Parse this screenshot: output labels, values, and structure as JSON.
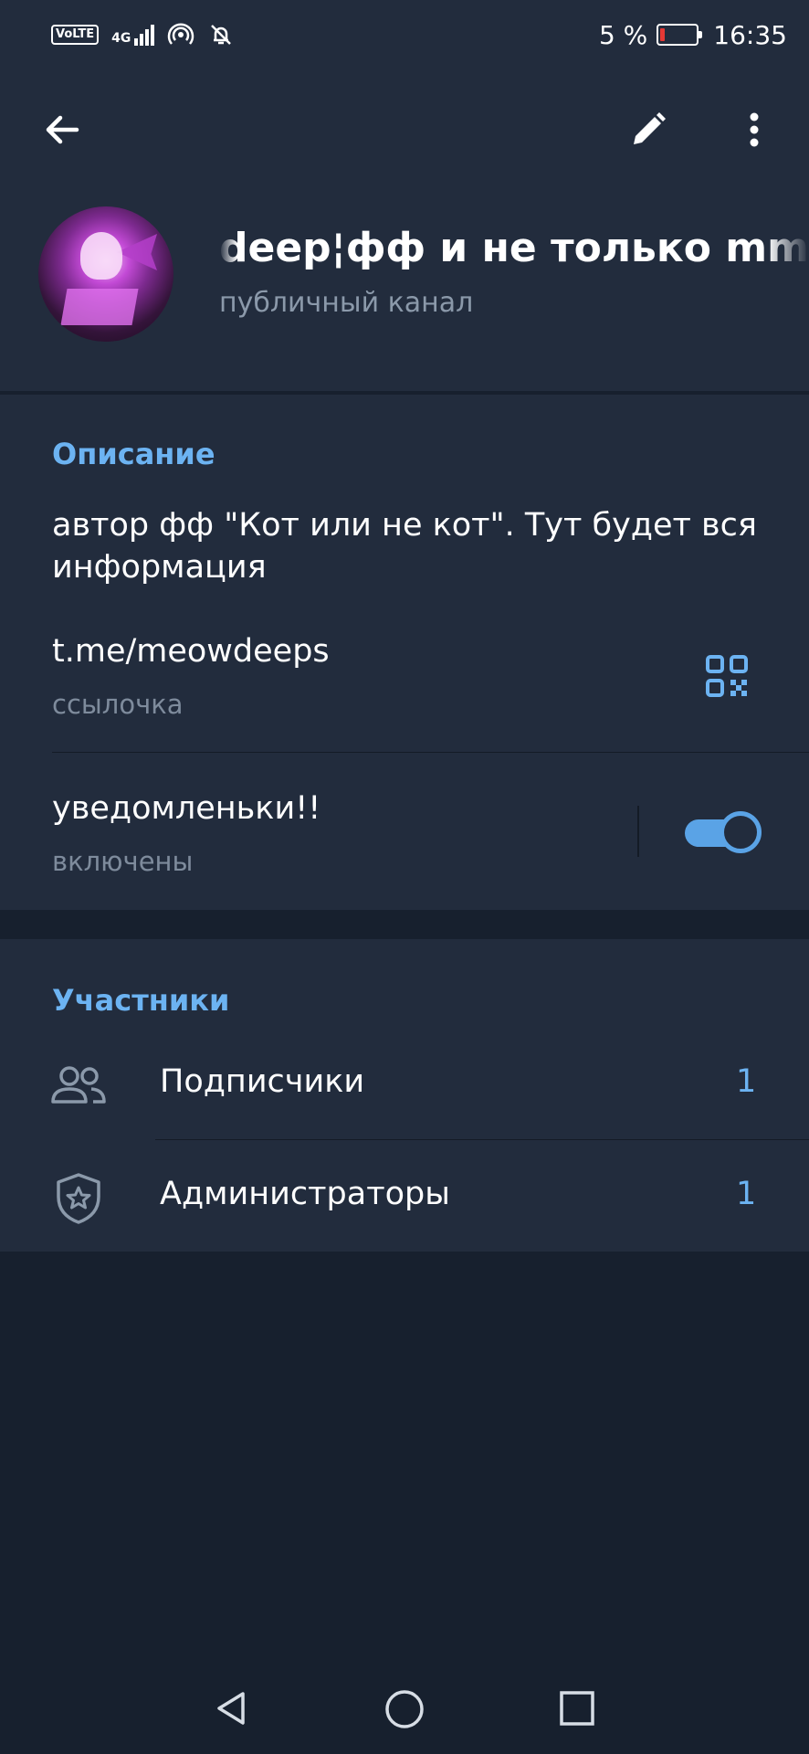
{
  "status_bar": {
    "volte": "VoLTE",
    "network": "4G",
    "battery": "5 %",
    "time": "16:35"
  },
  "toolbar": {
    "back_icon": "arrow-left-icon",
    "edit_icon": "pencil-icon",
    "more_icon": "more-vertical-icon"
  },
  "channel": {
    "title": "deep¦фф и не только    mme",
    "subtitle": "публичный канал"
  },
  "info": {
    "description_header": "Описание",
    "description_text": "автор фф \"Кот или не кот\". Тут будет вся информация",
    "link": "t.me/meowdeeps",
    "link_sub": "ссылочка",
    "notifications_label": "уведомленьки!!",
    "notifications_sub": "включены",
    "notifications_on": true
  },
  "members": {
    "header": "Участники",
    "subscribers_label": "Подписчики",
    "subscribers_count": "1",
    "admins_label": "Администраторы",
    "admins_count": "1"
  },
  "colors": {
    "accent": "#6cb3f2",
    "toggle": "#5aa3e6",
    "panel": "#222c3d",
    "background": "#17202e"
  }
}
